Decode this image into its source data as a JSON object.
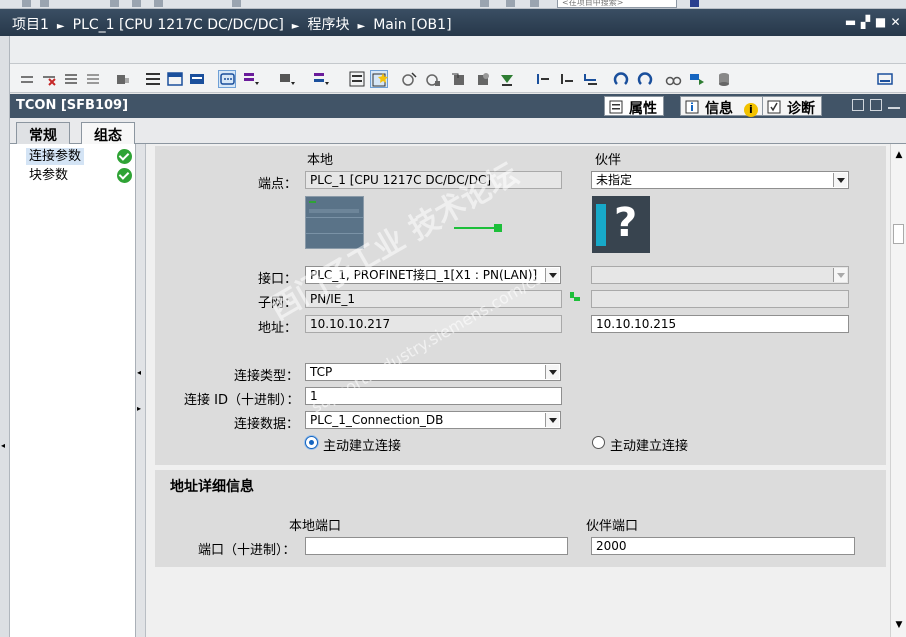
{
  "topstrip": {
    "search_placeholder": "<在项目中搜索>"
  },
  "titlebar": {
    "crumbs": [
      "项目1",
      "PLC_1 [CPU 1217C DC/DC/DC]",
      "程序块",
      "Main [OB1]"
    ],
    "separator": "►"
  },
  "panel": {
    "title": "TCON [SFB109]",
    "tabs": {
      "properties": "属性",
      "info": "信息",
      "diagnostics": "诊断"
    }
  },
  "inner_tabs": {
    "general": "常规",
    "config": "组态"
  },
  "nav": {
    "items": [
      {
        "label": "连接参数",
        "status": "ok"
      },
      {
        "label": "块参数",
        "status": "ok"
      }
    ]
  },
  "conn": {
    "col_local": "本地",
    "col_partner": "伙伴",
    "endpoint_label": "端点：",
    "local_endpoint": "PLC_1 [CPU 1217C DC/DC/DC]",
    "partner_endpoint": "未指定",
    "partner_icon_text": "?",
    "interface_label": "接口：",
    "local_interface": "PLC_1, PROFINET接口_1[X1 : PN(LAN)]",
    "partner_interface": "",
    "subnet_label": "子网：",
    "local_subnet": "PN/IE_1",
    "partner_subnet": "",
    "address_label": "地址：",
    "local_address": "10.10.10.217",
    "partner_address": "10.10.10.215",
    "conn_type_label": "连接类型：",
    "conn_type": "TCP",
    "conn_id_label": "连接 ID（十进制）：",
    "conn_id": "1",
    "conn_data_label": "连接数据：",
    "conn_data": "PLC_1_Connection_DB",
    "local_active_label": "主动建立连接",
    "partner_active_label": "主动建立连接",
    "local_active": true,
    "partner_active": false
  },
  "addr_details": {
    "title": "地址详细信息",
    "col_local_port": "本地端口",
    "col_partner_port": "伙伴端口",
    "port_label": "端口（十进制）：",
    "local_port": "",
    "partner_port": "2000"
  },
  "watermark": {
    "line1": "西门子工业 技术论坛",
    "line2": "support.industry.siemens.com/cs"
  },
  "colors": {
    "titlebar": "#27384a",
    "panel_header": "#415467",
    "ok_green": "#2fa335",
    "link_green": "#1dbf3a"
  }
}
